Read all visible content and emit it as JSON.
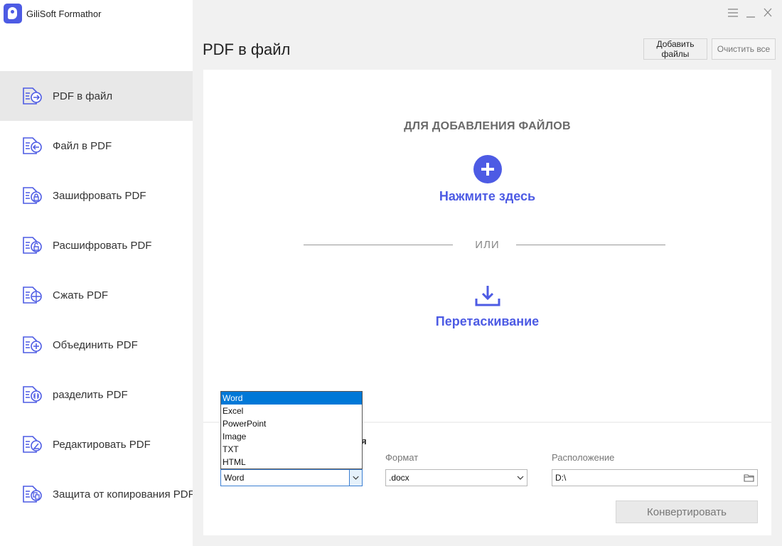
{
  "app": {
    "title": "GiliSoft Formathor"
  },
  "window_controls": {
    "menu_icon": "hamburger-icon",
    "minimize_icon": "minimize-icon",
    "close_icon": "close-icon"
  },
  "sidebar": {
    "items": [
      {
        "label": "PDF в файл",
        "icon": "pdf-to-file-icon",
        "active": true
      },
      {
        "label": "Файл в PDF",
        "icon": "file-to-pdf-icon",
        "active": false
      },
      {
        "label": "Зашифровать PDF",
        "icon": "encrypt-pdf-icon",
        "active": false
      },
      {
        "label": "Расшифровать PDF",
        "icon": "decrypt-pdf-icon",
        "active": false
      },
      {
        "label": "Сжать PDF",
        "icon": "compress-pdf-icon",
        "active": false
      },
      {
        "label": "Объединить PDF",
        "icon": "merge-pdf-icon",
        "active": false
      },
      {
        "label": "разделить PDF",
        "icon": "split-pdf-icon",
        "active": false
      },
      {
        "label": "Редактировать PDF",
        "icon": "edit-pdf-icon",
        "active": false
      },
      {
        "label": "Защита от копирования PDF",
        "icon": "copy-protect-pdf-icon",
        "active": false
      }
    ]
  },
  "header": {
    "title": "PDF в файл",
    "add_files_label": "Добавить файлы",
    "clear_all_label": "Очистить все"
  },
  "drop_area": {
    "heading": "ДЛЯ ДОБАВЛЕНИЯ ФАЙЛОВ",
    "click_here": "Нажмите здесь",
    "or_text": "ИЛИ",
    "drag_text": "Перетаскивание"
  },
  "settings": {
    "output_type_label_tail": "я",
    "output_type_value": "Word",
    "output_type_options": [
      "Word",
      "Excel",
      "PowerPoint",
      "Image",
      "TXT",
      "HTML"
    ],
    "output_type_selected_index": 0,
    "format_label": "Формат",
    "format_value": ".docx",
    "location_label": "Расположение",
    "location_value": "D:\\",
    "convert_label": "Конвертировать"
  },
  "colors": {
    "accent": "#4d5be4",
    "selection": "#0078d7",
    "sidebar_active": "#e8e8e8",
    "background": "#f1f1f1"
  }
}
